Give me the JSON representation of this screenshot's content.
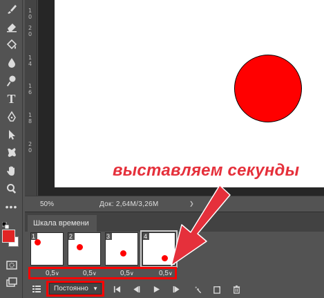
{
  "toolbar": {
    "tools": [
      {
        "name": "brush-icon"
      },
      {
        "name": "eraser-icon"
      },
      {
        "name": "paint-bucket-icon"
      },
      {
        "name": "blur-drop-icon"
      },
      {
        "name": "dodge-icon"
      },
      {
        "name": "type-tool",
        "label": "T"
      },
      {
        "name": "pen-icon"
      },
      {
        "name": "path-selection-icon"
      },
      {
        "name": "custom-shape-icon"
      },
      {
        "name": "hand-icon"
      },
      {
        "name": "zoom-icon"
      },
      {
        "name": "more-tools-icon"
      }
    ],
    "foreground_color": "#e02424",
    "background_color": "#ffffff"
  },
  "ruler": {
    "ticks": [
      "1",
      "0",
      "2",
      "0",
      "1",
      "4",
      "1",
      "6",
      "1",
      "8",
      "2",
      "0"
    ]
  },
  "canvas": {
    "shape_color": "#ff0000"
  },
  "annotation": {
    "text": "выставляем секунды",
    "color": "#e5303b"
  },
  "status": {
    "zoom": "50%",
    "doc": "Док: 2,64M/3,26M"
  },
  "timeline": {
    "tab_label": "Шкала времени",
    "frames": [
      {
        "number": "1",
        "delay": "0,5"
      },
      {
        "number": "2",
        "delay": "0,5"
      },
      {
        "number": "3",
        "delay": "0,5"
      },
      {
        "number": "4",
        "delay": "0,5"
      }
    ],
    "loop_option": "Постоянно",
    "highlight_color": "#ff0000"
  }
}
